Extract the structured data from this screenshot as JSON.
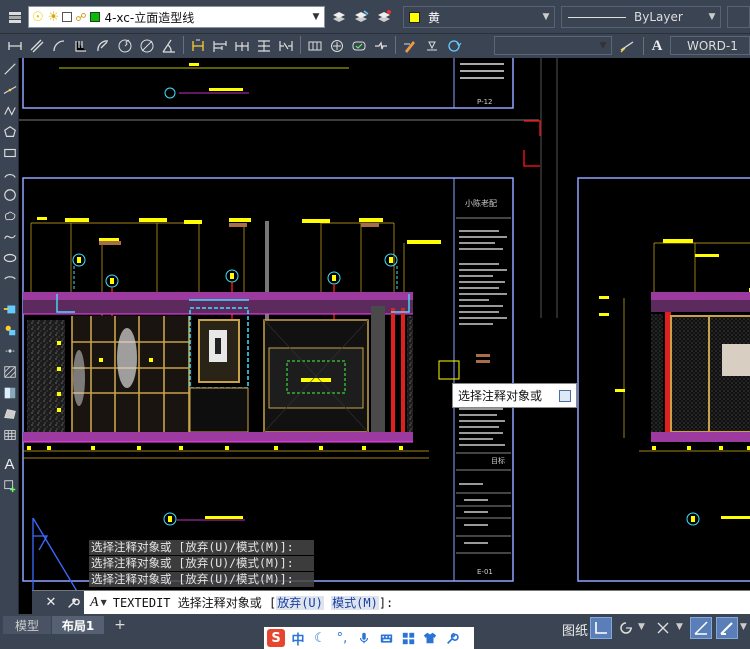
{
  "toolbar": {
    "layer_name": "4-xc-立面造型线",
    "layer_color": "#00c000",
    "color_name": "黄",
    "color_swatch": "#ffff00",
    "linetype": "ByLayer",
    "textstyle": "WORD-1",
    "row1_icons": [
      "layer-properties-icon",
      "lightbulb-icon",
      "sun-icon",
      "square-icon",
      "lock-icon"
    ],
    "row2_icons": [
      "dim-linear-icon",
      "dim-aligned-icon",
      "dim-arc-icon",
      "dim-ordinate-icon",
      "dim-radius-icon",
      "dim-jogged-icon",
      "dim-diameter-icon",
      "dim-angular-icon",
      "quick-dim-icon",
      "dim-baseline-icon",
      "dim-continue-icon",
      "dim-space-icon",
      "dim-break-icon",
      "tolerance-icon",
      "center-mark-icon",
      "inspect-icon",
      "jogged-linear-icon",
      "dim-edit-icon",
      "dim-text-edit-icon",
      "dim-update-icon"
    ]
  },
  "left_tools": [
    "line-icon",
    "construction-line-icon",
    "polyline-icon",
    "polygon-icon",
    "rectangle-icon",
    "arc-icon",
    "circle-icon",
    "revcloud-icon",
    "spline-icon",
    "ellipse-icon",
    "ellipse-arc-icon",
    "insert-block-icon",
    "make-block-icon",
    "point-icon",
    "hatch-icon",
    "gradient-icon",
    "region-icon",
    "table-icon",
    "mtext-icon",
    "add-selected-icon"
  ],
  "left_text_tool": "A",
  "drawing": {
    "sheet_title": "小陈老配",
    "sheet_p12": "P-12",
    "sheet_e01": "E-01",
    "sheet_label_mid": "目标"
  },
  "tooltip": {
    "text": "选择注释对象或"
  },
  "command": {
    "history": [
      "选择注释对象或 [放弃(U)/模式(M)]:",
      "选择注释对象或 [放弃(U)/模式(M)]:",
      "选择注释对象或 [放弃(U)/模式(M)]:"
    ],
    "current_prefix": "TEXTEDIT 选择注释对象或 [",
    "opt1": "放弃(U)",
    "opt2": "模式(M)",
    "suffix": "]:"
  },
  "layout_tabs": {
    "model": "模型",
    "layout1": "布局1",
    "add": "+"
  },
  "status": {
    "paper_label": "图纸",
    "ime_icons": [
      "sogou-logo-icon",
      "chinese-mode-icon",
      "moon-icon",
      "punctuation-icon",
      "microphone-icon",
      "keyboard-icon",
      "grid-icon",
      "shirt-icon",
      "wrench-icon"
    ],
    "ime_chinese": "中"
  }
}
